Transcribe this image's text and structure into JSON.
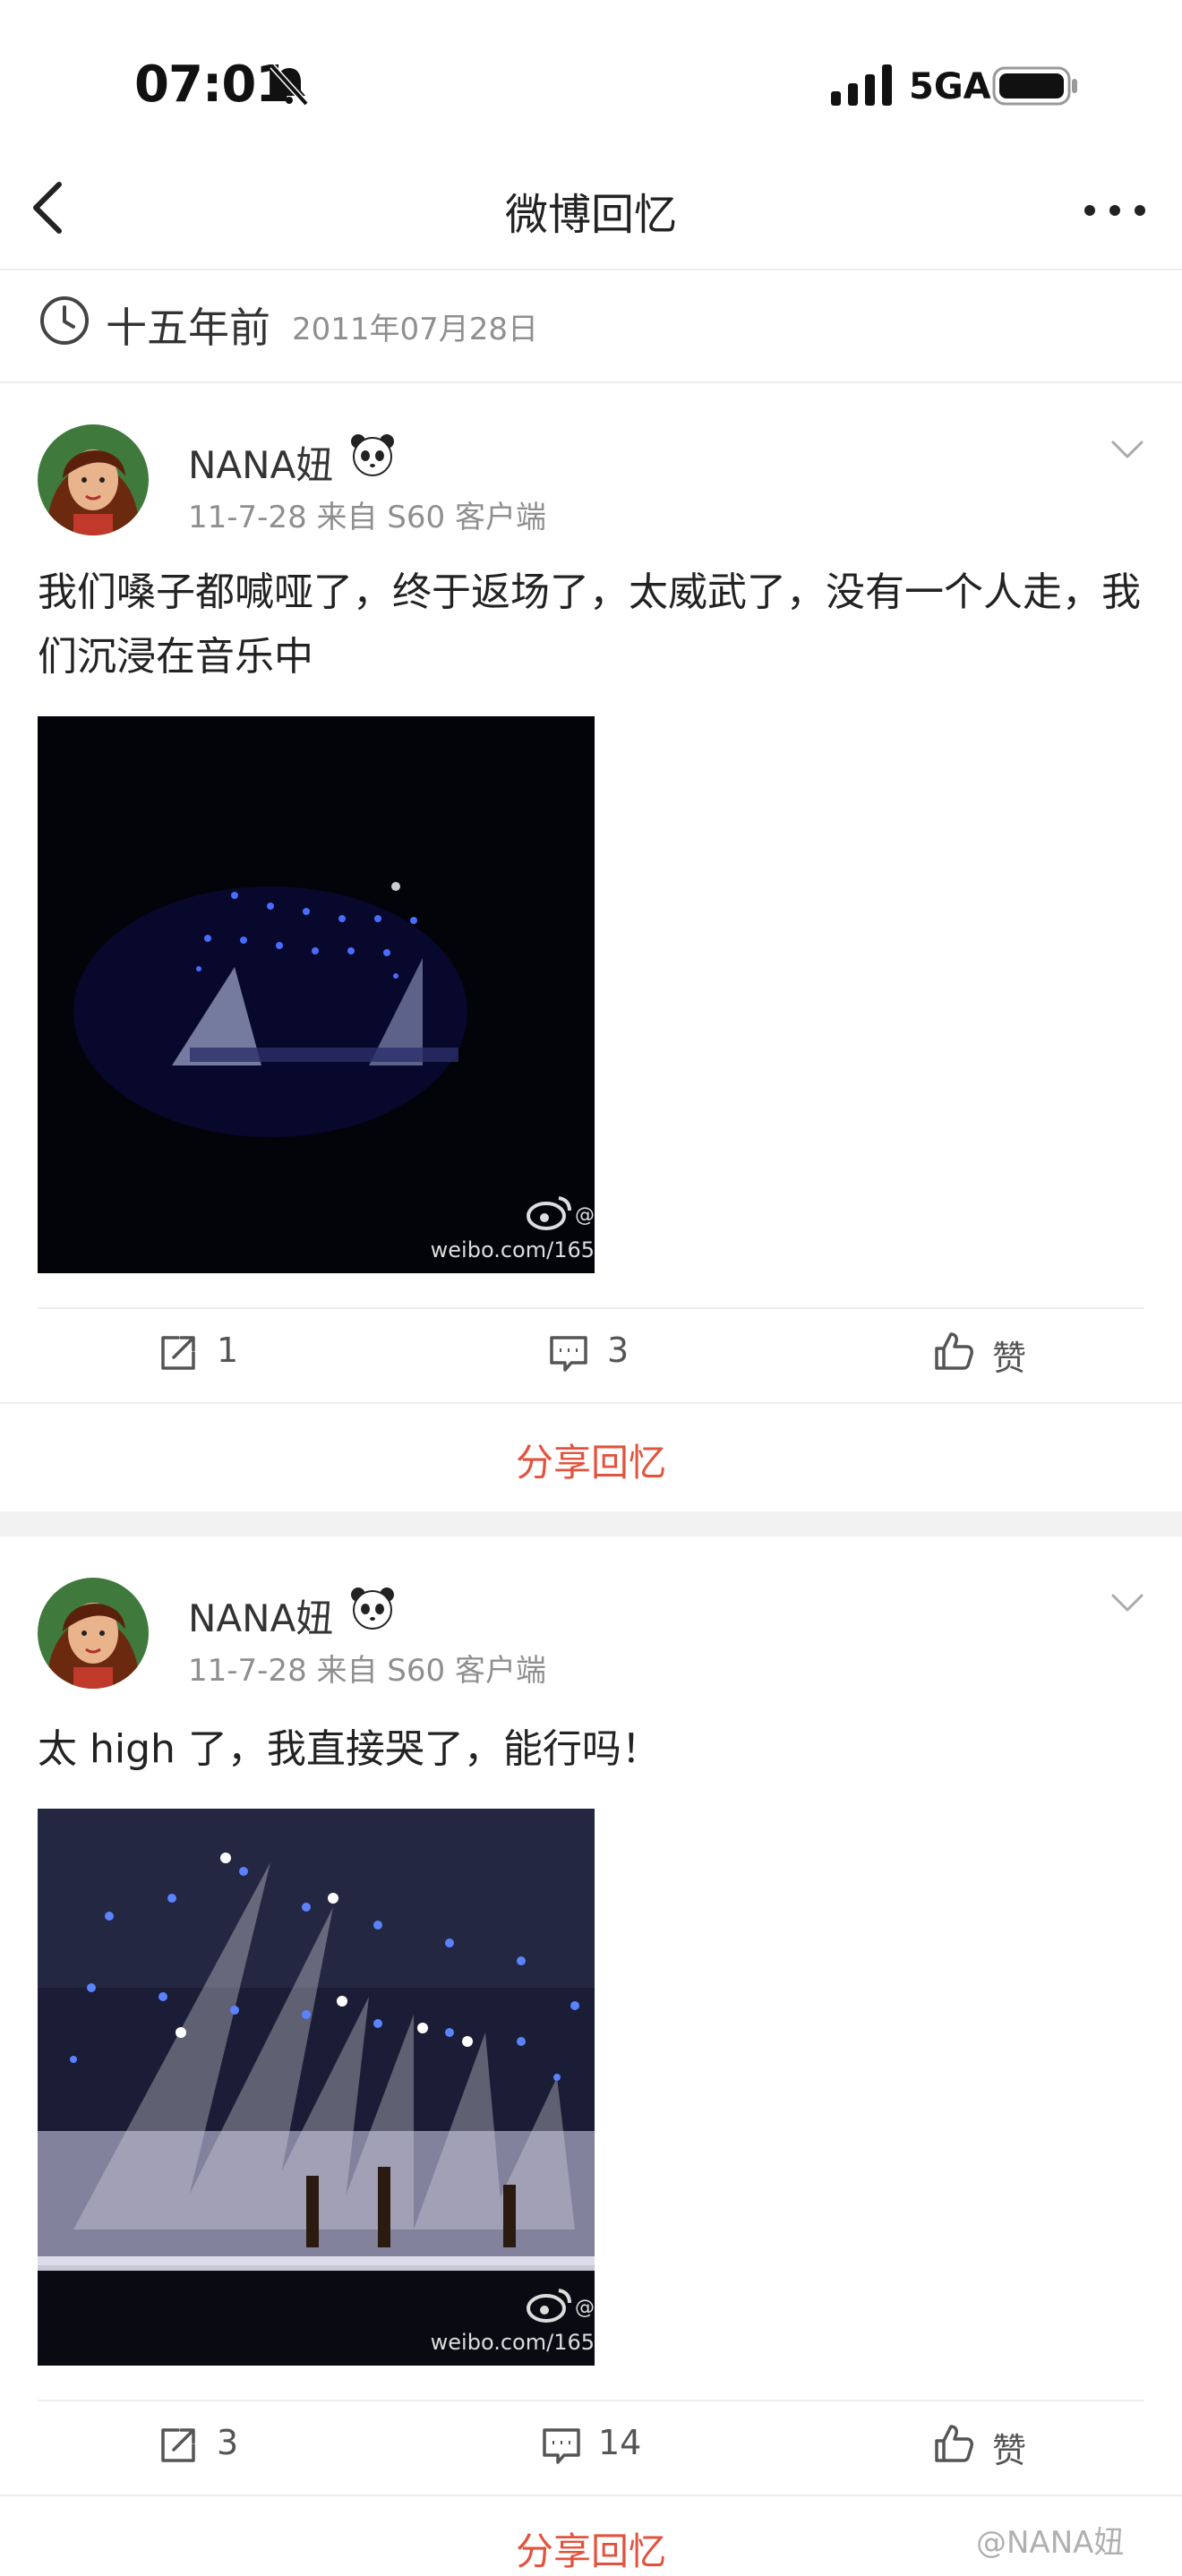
{
  "status": {
    "time": "07:01",
    "network": "5GA"
  },
  "nav": {
    "title": "微博回忆"
  },
  "header": {
    "ago": "十五年前",
    "date": "2011年07月28日"
  },
  "posts": [
    {
      "author": "NANA妞",
      "meta": "11-7-28  来自 S60 客户端",
      "text": "我们嗓子都喊哑了，终于返场了，太威武了，没有一个人走，我们沉浸在音乐中",
      "watermark": "weibo.com/165",
      "watermark_at": "@",
      "reposts": "1",
      "comments": "3",
      "like_label": "赞",
      "share_label": "分享回忆"
    },
    {
      "author": "NANA妞",
      "meta": "11-7-28  来自 S60 客户端",
      "text": "太 high 了，我直接哭了，能行吗！",
      "watermark": "weibo.com/165",
      "watermark_at": "@",
      "reposts": "3",
      "comments": "14",
      "like_label": "赞",
      "share_label": "分享回忆"
    }
  ],
  "credit": "@NANA妞",
  "colors": {
    "accent": "#e2533e",
    "muted": "#8f8f8f"
  }
}
